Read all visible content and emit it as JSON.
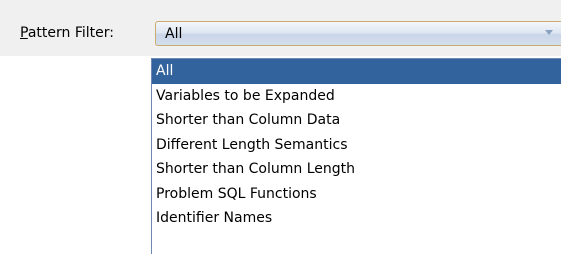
{
  "pattern_filter": {
    "label_mnemonic": "P",
    "label_rest": "attern Filter:",
    "selected_value": "All",
    "options": [
      "All",
      "Variables to be Expanded",
      "Shorter than Column Data",
      "Different Length Semantics",
      "Shorter than Column Length",
      "Problem SQL Functions",
      "Identifier Names"
    ]
  },
  "colors": {
    "selection_background": "#32639c",
    "selection_text": "#ffffff",
    "combo_border": "#c9ad6c"
  },
  "icons": {
    "combo_arrow": "chevron-down-icon"
  }
}
